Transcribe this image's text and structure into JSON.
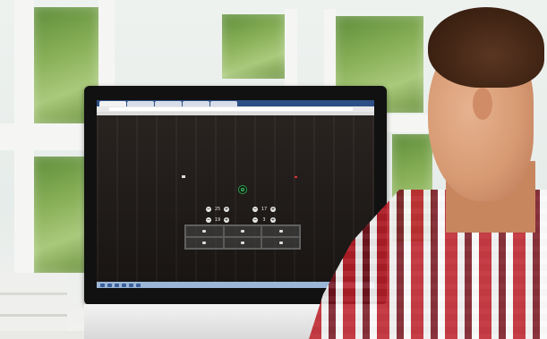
{
  "browser": {
    "tabs": [
      "",
      "",
      "",
      "",
      "",
      ""
    ],
    "address": "",
    "bookmarks": ""
  },
  "app": {
    "breadcrumb": "",
    "steppers": [
      {
        "label": "",
        "value": "25"
      },
      {
        "label": "",
        "value": "19"
      },
      {
        "label": "",
        "value": "17"
      },
      {
        "label": "",
        "value": "3"
      }
    ],
    "grid_cells": [
      "",
      "",
      "",
      "",
      "",
      ""
    ]
  },
  "colors": {
    "accent_green": "#2e9e47",
    "alert_red": "#d33333"
  },
  "icons": [
    "home-icon",
    "power-icon",
    "minus-icon",
    "plus-icon"
  ]
}
